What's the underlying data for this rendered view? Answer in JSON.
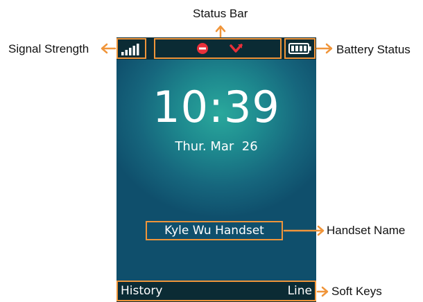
{
  "screen": {
    "time": "10:39",
    "date": "Thur. Mar  26",
    "handset_name": "Kyle Wu Handset",
    "softkeys": {
      "left": "History",
      "right": "Line"
    }
  },
  "callouts": {
    "status_bar": "Status Bar",
    "signal_strength": "Signal Strength",
    "battery_status": "Battery Status",
    "handset_name": "Handset Name",
    "soft_keys": "Soft Keys"
  },
  "icons": {
    "signal": "signal-strength-icon",
    "dnd": "do-not-disturb-icon",
    "missed_call": "missed-call-icon",
    "battery": "battery-full-icon"
  },
  "colors": {
    "accent": "#f0953a",
    "status_icon_red": "#e8303a",
    "bar_background": "#0b2b34",
    "screen_teal": "#1e8a8f"
  }
}
